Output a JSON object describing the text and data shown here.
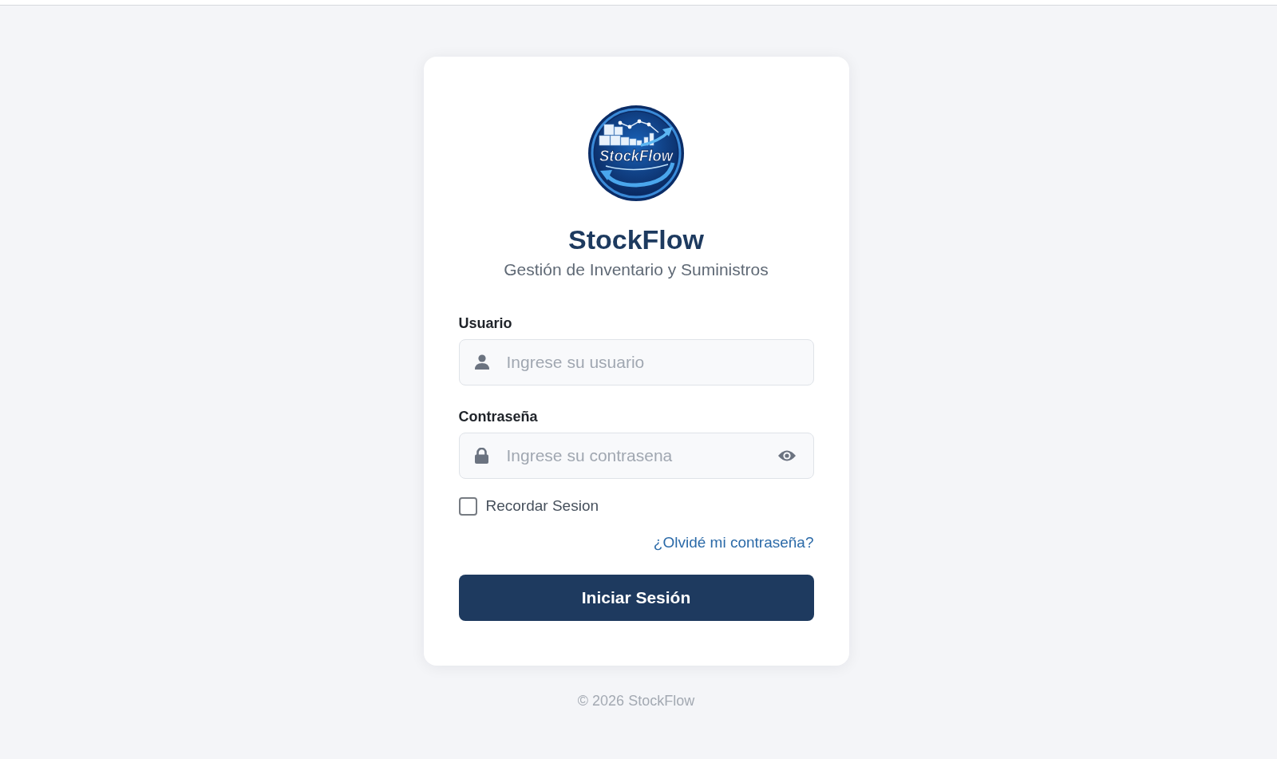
{
  "logo": {
    "text": "StockFlow"
  },
  "header": {
    "title": "StockFlow",
    "subtitle": "Gestión de Inventario y Suministros"
  },
  "form": {
    "fields": [
      {
        "kind": "text",
        "label": "Usuario",
        "placeholder": "Ingrese su usuario"
      },
      {
        "kind": "password",
        "label": "Contraseña",
        "placeholder": "Ingrese su contrasena"
      }
    ],
    "remember": {
      "label": "Recordar Sesion",
      "checked": false
    },
    "forgot_link": "¿Olvidé mi contraseña?",
    "submit": "Iniciar Sesión"
  },
  "footer": "© 2026 StockFlow"
}
